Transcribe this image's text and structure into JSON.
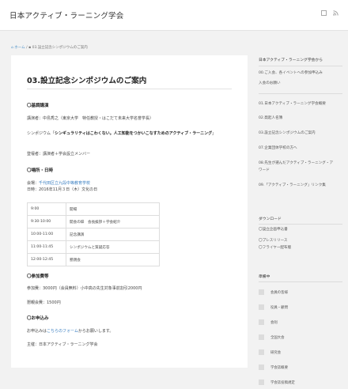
{
  "header": {
    "site_title": "日本アクティブ・ラーニング学会",
    "icons": [
      "window-icon",
      "rss-icon"
    ]
  },
  "breadcrumb": {
    "home": "ホーム",
    "separator": "/",
    "current": "03.設立記念シンポジウムのご案内"
  },
  "article": {
    "title": "03.設立記念シンポジウムのご案内",
    "keynote_heading": "〇基調講演",
    "speaker": "講演者：中島秀之（東京大学　特任教授・はこだて未来大学名誉学長）",
    "symposium_prefix": "シンポジウム「",
    "symposium_title": "シンギュラリティはこわくない。人工知能をつかいこなすためのアクティブ・ラーニング",
    "symposium_suffix": "」",
    "panelists": "登壇者：講演者＋学会設立メンバー",
    "venue_heading": "〇場所・日時",
    "venue_label": "会場：",
    "venue_link": "千代田区立九段中等教育学校",
    "date": "日時：2016年11月３日（木）文化の日",
    "schedule": [
      {
        "time": "9:00",
        "event": "開場"
      },
      {
        "time": "9:30-10:00",
        "event": "開会の辞　会長挨拶＋学会紹介"
      },
      {
        "time": "10:00-11:00",
        "event": "記念講演"
      },
      {
        "time": "11:00-11:45",
        "event": "シンポジウムと質疑応答"
      },
      {
        "time": "12:00-12:45",
        "event": "懇親会"
      }
    ],
    "fee_heading": "〇参加費等",
    "fee": "参加費：3000円（会員無料）小中高の先生対象事前割引2000円",
    "party_fee": "懇親会費：1500円",
    "apply_heading": "〇お申込み",
    "apply_prefix": "お申込みは",
    "apply_link": "こちらのフォーム",
    "apply_suffix": "からお願いします。",
    "organizer": "主催：日本アクティブ・ラーニング学会"
  },
  "sidebar": {
    "site_heading": "日本アクティブ・ラーニング学会から",
    "menu_first_line1": "00.ご入会、各イベントへの参加申込み",
    "menu_first_line2": "入会のお願い",
    "menu": [
      "01.日本アクティブ・ラーニング学会概要",
      "02.発起人名簿",
      "03.設立記念シンポジウムのご案内",
      "07.企業団体学校の方へ"
    ],
    "menu_last_line1": "08.先生が選んだアクティブ・ラーニング・アワード",
    "menu_last_line2": "ワード",
    "menu_extra": "09.「アクティブ・ラーニング」リンク集",
    "download_heading": "ダウンロード",
    "downloads": [
      "〇設立企画申込書",
      "〇プレスリリース",
      "〇フライヤー配布版"
    ],
    "tags_heading": "準備中",
    "tags": [
      "会員の皆様",
      "役員・顧問",
      "会則",
      "全国大会",
      "研究会",
      "学会誌概要",
      "学会誌投稿規定"
    ]
  }
}
